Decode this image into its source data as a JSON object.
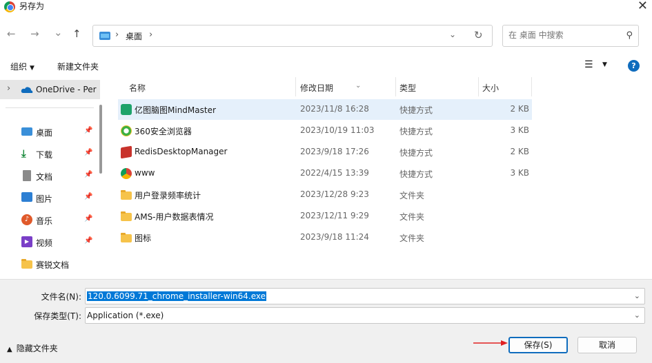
{
  "window": {
    "title": "另存为"
  },
  "nav": {
    "back": "←",
    "forward": "→",
    "recent": "⌄",
    "up": "↑",
    "breadcrumb": "桌面",
    "search_placeholder": "在 桌面 中搜索"
  },
  "toolbar": {
    "organize": "组织",
    "new_folder": "新建文件夹"
  },
  "sidebar": {
    "onedrive": "OneDrive - Per",
    "items": [
      {
        "label": "桌面",
        "icon": "desktop-icon",
        "color": "#3a8fd9"
      },
      {
        "label": "下载",
        "icon": "download-icon",
        "color": "#1a8a3c"
      },
      {
        "label": "文档",
        "icon": "document-icon",
        "color": "#7a7a7a"
      },
      {
        "label": "图片",
        "icon": "picture-icon",
        "color": "#2d7fd3"
      },
      {
        "label": "音乐",
        "icon": "music-icon",
        "color": "#e05a2b"
      },
      {
        "label": "视频",
        "icon": "video-icon",
        "color": "#7a3fc7"
      },
      {
        "label": "赛锐文档",
        "icon": "folder-icon",
        "color": "#f6c34a"
      }
    ]
  },
  "columns": {
    "name": "名称",
    "date": "修改日期",
    "type": "类型",
    "size": "大小"
  },
  "files": [
    {
      "name": "亿图脑图MindMaster",
      "date": "2023/11/8 16:28",
      "type": "快捷方式",
      "size": "2 KB",
      "icon": "mindmaster-icon",
      "selected": true
    },
    {
      "name": "360安全浏览器",
      "date": "2023/10/19 11:03",
      "type": "快捷方式",
      "size": "3 KB",
      "icon": "browser-360-icon"
    },
    {
      "name": "RedisDesktopManager",
      "date": "2023/9/18 17:26",
      "type": "快捷方式",
      "size": "2 KB",
      "icon": "redis-icon"
    },
    {
      "name": "www",
      "date": "2022/4/15 13:39",
      "type": "快捷方式",
      "size": "3 KB",
      "icon": "chrome-icon"
    },
    {
      "name": "用户登录频率统计",
      "date": "2023/12/28 9:23",
      "type": "文件夹",
      "size": "",
      "icon": "folder-icon"
    },
    {
      "name": "AMS-用户数据表情况",
      "date": "2023/12/11 9:29",
      "type": "文件夹",
      "size": "",
      "icon": "folder-icon"
    },
    {
      "name": "图标",
      "date": "2023/9/18 11:24",
      "type": "文件夹",
      "size": "",
      "icon": "folder-icon"
    }
  ],
  "form": {
    "filename_label": "文件名(N):",
    "filename_value": "120.0.6099.71_chrome_installer-win64.exe",
    "filetype_label": "保存类型(T):",
    "filetype_value": "Application (*.exe)"
  },
  "footer": {
    "hide_folders": "隐藏文件夹",
    "save": "保存(S)",
    "cancel": "取消"
  }
}
